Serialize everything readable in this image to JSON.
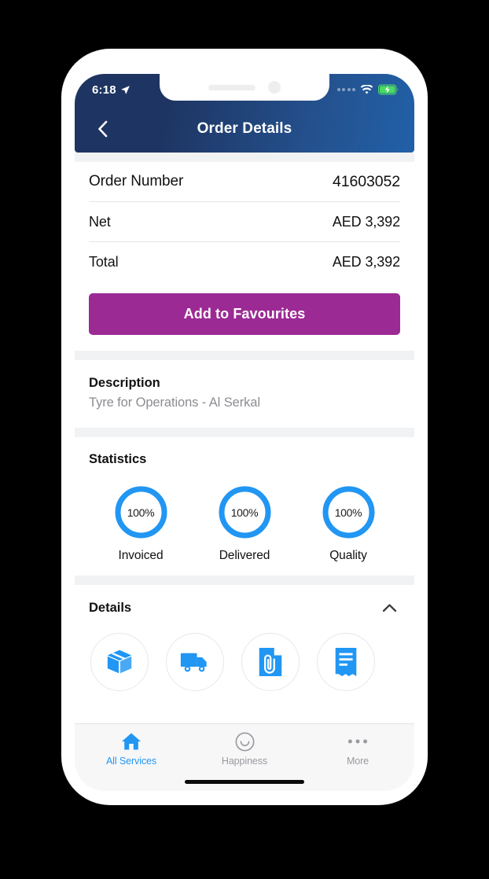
{
  "status_bar": {
    "time": "6:18",
    "location_icon": "location-arrow-icon",
    "signal_icon": "signal-dots-icon",
    "wifi_icon": "wifi-icon",
    "battery_icon": "battery-charging-icon",
    "battery_color": "#4cd964"
  },
  "header": {
    "title": "Order Details",
    "back_icon": "chevron-left-icon",
    "gradient_start": "#1e3563",
    "gradient_end": "#2160a8"
  },
  "order_info": {
    "rows": [
      {
        "label": "Order Number",
        "value": "41603052"
      },
      {
        "label": "Net",
        "value": "AED 3,392"
      },
      {
        "label": "Total",
        "value": "AED 3,392"
      }
    ]
  },
  "favourites": {
    "label": "Add to Favourites",
    "color": "#9c2a94"
  },
  "description": {
    "title": "Description",
    "text": "Tyre for Operations - Al Serkal"
  },
  "statistics": {
    "title": "Statistics",
    "accent_color": "#2196f3",
    "items": [
      {
        "value": "100%",
        "percent": 100,
        "label": "Invoiced"
      },
      {
        "value": "100%",
        "percent": 100,
        "label": "Delivered"
      },
      {
        "value": "100%",
        "percent": 100,
        "label": "Quality"
      }
    ]
  },
  "details": {
    "title": "Details",
    "toggle_icon": "chevron-up-icon",
    "expanded": true,
    "icons": [
      {
        "name": "package-box-icon"
      },
      {
        "name": "delivery-truck-icon"
      },
      {
        "name": "document-attachment-icon"
      },
      {
        "name": "invoice-list-icon"
      }
    ]
  },
  "tab_bar": {
    "active_color": "#2196f3",
    "inactive_color": "#9a9aa0",
    "tabs": [
      {
        "label": "All Services",
        "icon": "home-icon",
        "active": true
      },
      {
        "label": "Happiness",
        "icon": "smiley-face-icon",
        "active": false
      },
      {
        "label": "More",
        "icon": "ellipsis-icon",
        "active": false
      }
    ]
  }
}
